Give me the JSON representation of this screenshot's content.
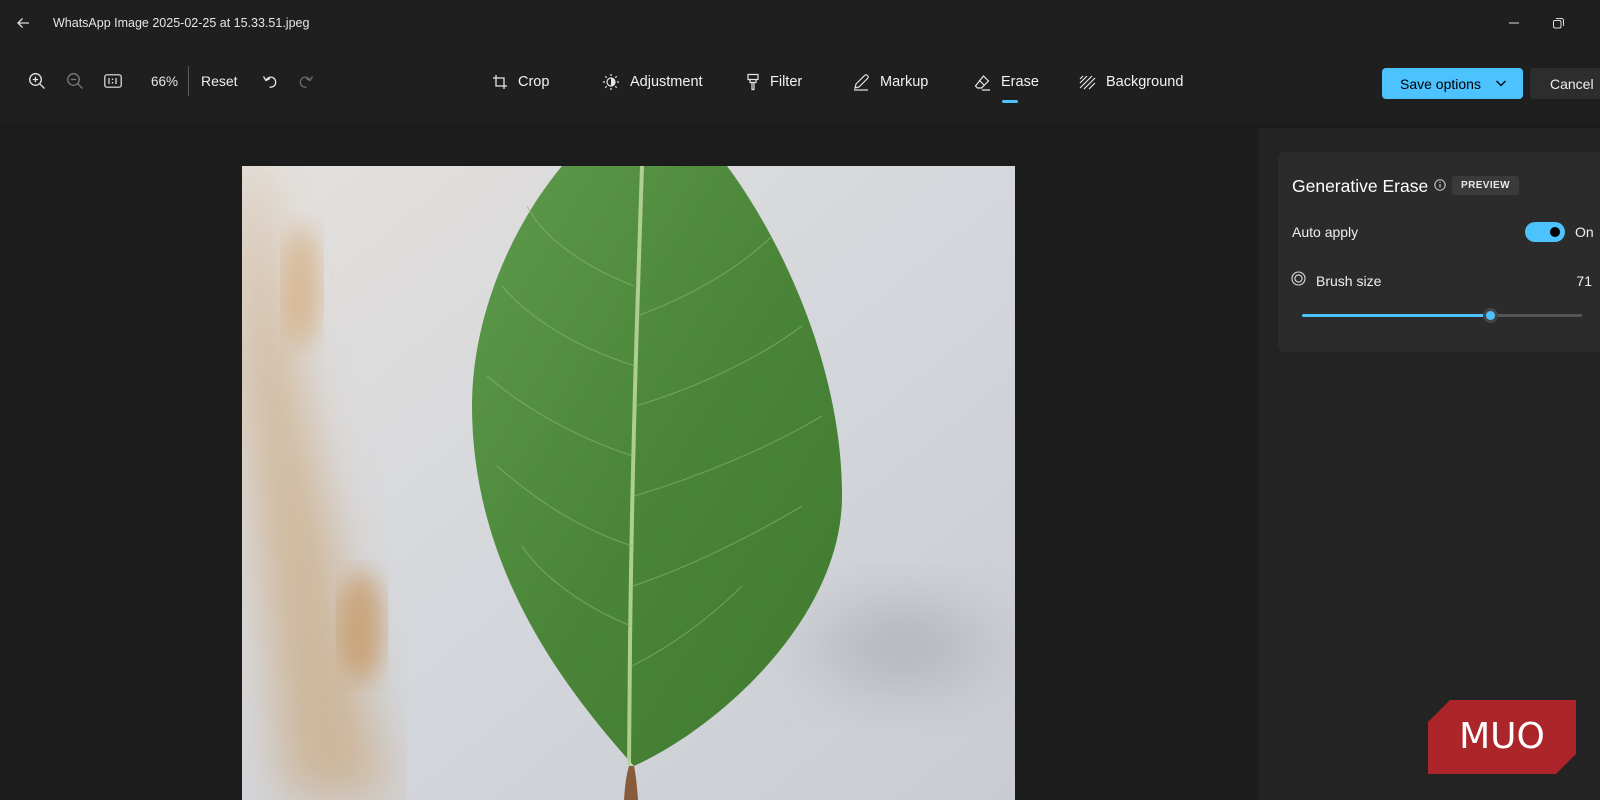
{
  "window": {
    "file_name": "WhatsApp Image 2025-02-25 at 15.33.51.jpeg"
  },
  "toolbar": {
    "zoom_level": "66%",
    "reset_label": "Reset",
    "tools": [
      {
        "label": "Crop",
        "icon": "crop-icon"
      },
      {
        "label": "Adjustment",
        "icon": "adjustment-icon"
      },
      {
        "label": "Filter",
        "icon": "filter-icon"
      },
      {
        "label": "Markup",
        "icon": "markup-icon"
      },
      {
        "label": "Erase",
        "icon": "erase-icon"
      },
      {
        "label": "Background",
        "icon": "background-icon"
      }
    ],
    "active_tool": "Erase",
    "save_label": "Save options",
    "cancel_label": "Cancel"
  },
  "panel": {
    "title": "Generative Erase",
    "badge": "PREVIEW",
    "auto_apply_label": "Auto apply",
    "auto_apply_state": "On",
    "auto_apply_on": true,
    "brush_size_label": "Brush size",
    "brush_size_value": "71",
    "brush_slider_fraction": 0.67
  },
  "watermark": {
    "text": "MUO"
  },
  "colors": {
    "accent": "#4cc2ff",
    "background": "#1c1c1c",
    "panel": "#2b2b2b",
    "watermark": "#c4262c"
  }
}
